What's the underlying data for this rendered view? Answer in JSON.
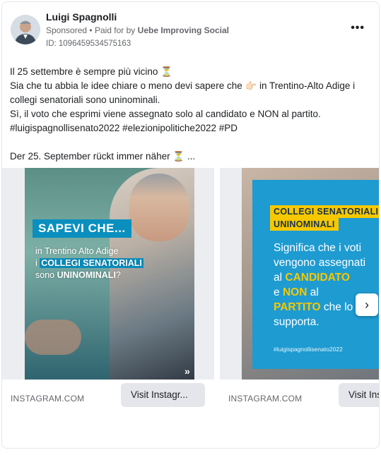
{
  "post": {
    "author": "Luigi Spagnolli",
    "sponsored": "Sponsored",
    "separator": "•",
    "paid_for_prefix": "Paid for by",
    "paid_for_by": "Uebe Improving Social",
    "ad_id": "ID: 1096459534575163",
    "more_label": "•••",
    "body_lines": [
      "Il 25 settembre è sempre più vicino ⏳",
      "Sia che tu abbia le idee chiare o meno devi sapere che 👉🏻 in Trentino-Alto Adige i",
      "collegi senatoriali sono uninominali.",
      "Sì, il voto che esprimi viene assegnato solo al candidato e NON al partito.",
      "#luigispagnollisenato2022 #elezionipolitiche2022 #PD"
    ],
    "body_second": "Der 25. September rückt immer näher ⏳ ..."
  },
  "carousel": {
    "next_icon": "›",
    "cards": [
      {
        "source": "INSTAGRAM.COM",
        "cta": "Visit Instagr...",
        "image": {
          "headline": "SAPEVI CHE...",
          "line1": "in Trentino Alto Adige",
          "line2_prefix": "i",
          "line2_highlight": "COLLEGI SENATORIALI",
          "line3_prefix": "sono",
          "line3_highlight": "UNINOMINALI",
          "line3_suffix": "?",
          "chevrons": "»"
        }
      },
      {
        "source": "INSTAGRAM.COM",
        "cta": "Visit Ins",
        "image": {
          "band1": "COLLEGI SENATORIALI",
          "band2": "UNINOMINALI",
          "t1": "Significa che i voti",
          "t2": "vengono assegnati",
          "t3_prefix": "al",
          "t3_highlight": "CANDIDATO",
          "t4_prefix": "e",
          "t4_highlight": "NON",
          "t4_suffix": "al",
          "t5_highlight": "PARTITO",
          "t5_suffix": "che lo",
          "t6": "supporta.",
          "hashtag": "#luigispagnollisenato2022"
        }
      }
    ]
  },
  "colors": {
    "accent_blue": "#0a8fbf",
    "accent_yellow": "#f6c800",
    "panel_blue": "#1e9bd1"
  }
}
